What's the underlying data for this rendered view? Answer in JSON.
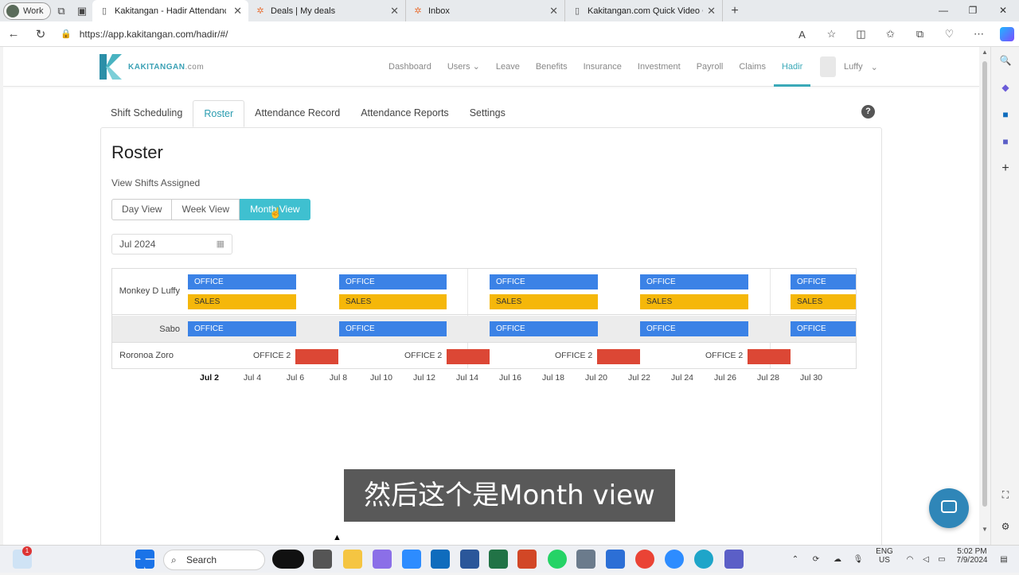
{
  "browser": {
    "profile": "Work",
    "tabs": [
      {
        "title": "Kakitangan - Hadir Attendance S",
        "active": true
      },
      {
        "title": "Deals | My deals",
        "active": false
      },
      {
        "title": "Inbox",
        "active": false
      },
      {
        "title": "Kakitangan.com Quick Video Gu",
        "active": false
      }
    ],
    "url": "https://app.kakitangan.com/hadir/#/"
  },
  "app": {
    "logo_text": "KAKITANGAN",
    "logo_suffix": ".com",
    "menu": [
      "Dashboard",
      "Users",
      "Leave",
      "Benefits",
      "Insurance",
      "Investment",
      "Payroll",
      "Claims",
      "Hadir"
    ],
    "active_menu": "Hadir",
    "user_name": "Luffy",
    "subtabs": [
      "Shift Scheduling",
      "Roster",
      "Attendance Record",
      "Attendance Reports",
      "Settings"
    ],
    "active_subtab": "Roster",
    "help_label": "?"
  },
  "roster": {
    "title": "Roster",
    "view_label": "View Shifts Assigned",
    "views": [
      "Day View",
      "Week View",
      "Month View"
    ],
    "active_view": "Month View",
    "month": "Jul 2024",
    "employees": [
      {
        "name": "Monkey D Luffy",
        "shifts": [
          "OFFICE",
          "SALES"
        ]
      },
      {
        "name": "Sabo",
        "shifts": [
          "OFFICE"
        ]
      },
      {
        "name": "Roronoa Zoro",
        "shifts": [
          "OFFICE 2"
        ]
      }
    ],
    "x_ticks": [
      "Jul 2",
      "Jul 4",
      "Jul 6",
      "Jul 8",
      "Jul 10",
      "Jul 12",
      "Jul 14",
      "Jul 16",
      "Jul 18",
      "Jul 20",
      "Jul 22",
      "Jul 24",
      "Jul 26",
      "Jul 28",
      "Jul 30"
    ]
  },
  "subtitle": "然后这个是Month view",
  "taskbar": {
    "search_placeholder": "Search",
    "lang": "ENG",
    "region": "US",
    "time": "5:02 PM",
    "date": "7/9/2024",
    "notif_count": "1"
  },
  "colors": {
    "accent": "#3aa9b8",
    "office": "#3b82e6",
    "sales": "#f5b70a",
    "office2": "#dc4735"
  }
}
